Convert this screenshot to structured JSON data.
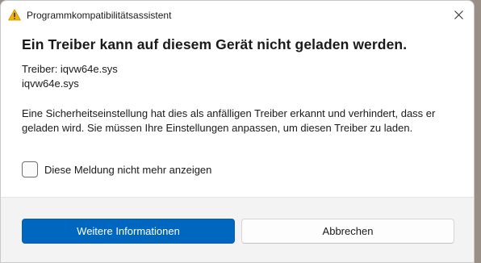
{
  "window": {
    "title": "Programmkompatibilitätsassistent",
    "close_glyph": "close-icon",
    "warning_icon": "warning-icon",
    "warning_color": "#e8a500"
  },
  "content": {
    "heading": "Ein Treiber kann auf diesem Gerät nicht geladen werden.",
    "driver_line_1": "Treiber: iqvw64e.sys",
    "driver_line_2": "iqvw64e.sys",
    "message": "Eine Sicherheitseinstellung hat dies als anfälligen Treiber erkannt und verhindert, dass er geladen wird. Sie müssen Ihre Einstellungen anpassen, um diesen Treiber zu laden."
  },
  "checkbox": {
    "label": "Diese Meldung nicht mehr anzeigen",
    "checked": false
  },
  "buttons": {
    "more_info": "Weitere Informationen",
    "cancel": "Abbrechen"
  },
  "colors": {
    "primary": "#0067c0",
    "footer_bg": "#f3f3f3"
  }
}
